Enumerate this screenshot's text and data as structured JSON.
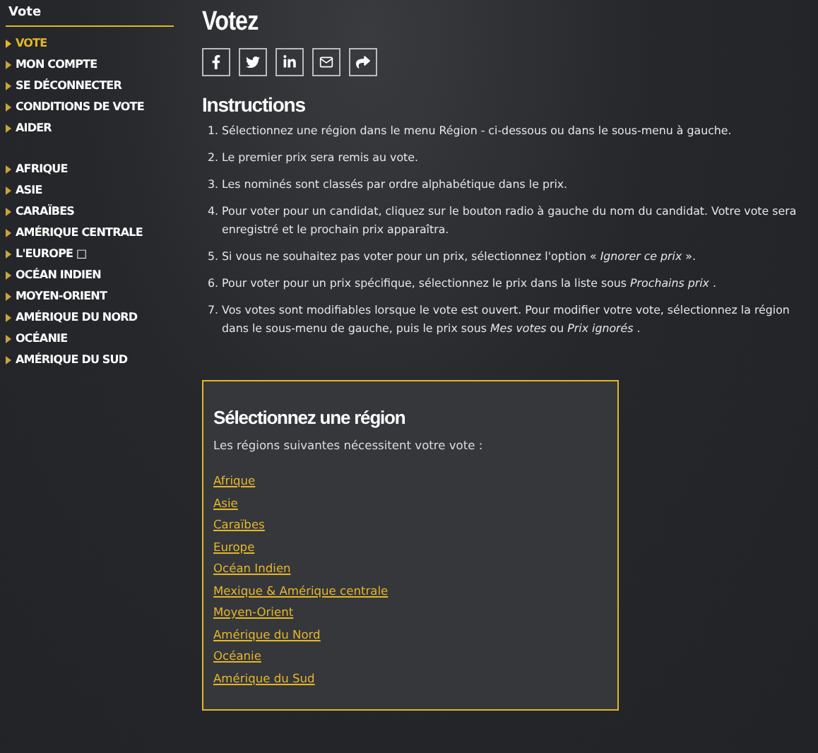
{
  "sidebar": {
    "title": "Vote",
    "groups": [
      [
        {
          "label": "VOTE",
          "selected": true
        },
        {
          "label": "MON COMPTE",
          "selected": false
        },
        {
          "label": "SE DÉCONNECTER",
          "selected": false
        },
        {
          "label": "CONDITIONS DE VOTE",
          "selected": false
        },
        {
          "label": "AIDER",
          "selected": false
        }
      ],
      [
        {
          "label": "AFRIQUE",
          "selected": false
        },
        {
          "label": "ASIE",
          "selected": false
        },
        {
          "label": "CARAÏBES",
          "selected": false
        },
        {
          "label": "AMÉRIQUE CENTRALE",
          "selected": false
        },
        {
          "label": "L'EUROPE □",
          "selected": false
        },
        {
          "label": "OCÉAN INDIEN",
          "selected": false
        },
        {
          "label": "MOYEN-ORIENT",
          "selected": false
        },
        {
          "label": "AMÉRIQUE DU NORD",
          "selected": false
        },
        {
          "label": "OCÉANIE",
          "selected": false
        },
        {
          "label": "AMÉRIQUE DU SUD",
          "selected": false
        }
      ]
    ]
  },
  "page": {
    "title": "Votez",
    "share_buttons": [
      {
        "kind": "facebook"
      },
      {
        "kind": "twitter"
      },
      {
        "kind": "linkedin"
      },
      {
        "kind": "email"
      },
      {
        "kind": "share"
      }
    ],
    "instructions_title": "Instructions",
    "instructions": [
      "1. Sélectionnez une région dans le menu Région - ci-dessous ou dans le sous-menu à gauche.",
      "2. Le premier prix sera remis au vote.",
      "3. Les nominés sont classés par ordre alphabétique dans le prix.",
      "4. Pour voter pour un candidat, cliquez sur le bouton radio à gauche du nom du candidat. Votre vote sera enregistré et le prochain prix apparaîtra.",
      "5. Si vous ne souhaitez pas voter pour un prix, sélectionnez l'option « *Ignorer ce prix* ».",
      "6. Pour voter pour un prix spécifique, sélectionnez le prix dans la liste sous *Prochains prix* .",
      "7. Vos votes sont modifiables lorsque le vote est ouvert. Pour modifier votre vote, sélectionnez la région dans le sous-menu de gauche, puis le prix sous *Mes votes* ou *Prix ignorés* ."
    ]
  },
  "region_box": {
    "title": "Sélectionnez une région",
    "subtitle": "Les régions suivantes nécessitent votre vote :",
    "links": [
      "Afrique",
      "Asie",
      "Caraïbes",
      "Europe",
      "Océan Indien",
      "Mexique & Amérique centrale",
      "Moyen-Orient",
      "Amérique du Nord",
      "Océanie",
      "Amérique du Sud"
    ]
  }
}
